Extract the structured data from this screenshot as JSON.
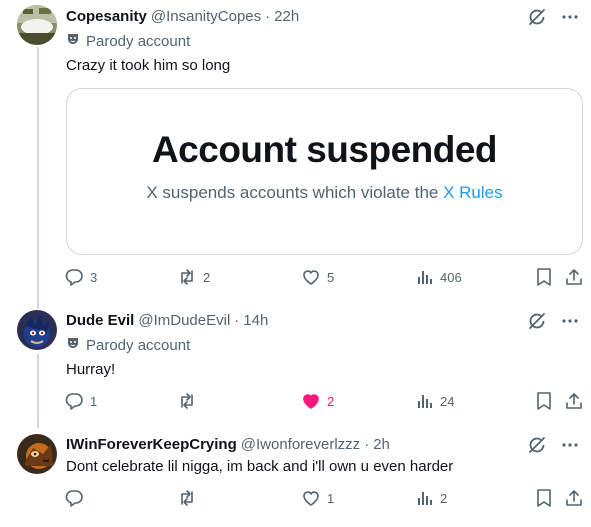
{
  "tweets": [
    {
      "name": "Copesanity",
      "handle": "@InsanityCopes",
      "time": "22h",
      "parody_label": "Parody account",
      "text": "Crazy it took him so long",
      "card": {
        "title": "Account suspended",
        "subtitle_prefix": "X suspends accounts which violate the ",
        "subtitle_link": "X Rules"
      },
      "replies": "3",
      "reposts": "2",
      "likes": "5",
      "views": "406"
    },
    {
      "name": "Dude Evil",
      "handle": "@ImDudeEvil",
      "time": "14h",
      "parody_label": "Parody account",
      "text": "Hurray!",
      "replies": "1",
      "reposts": "",
      "likes": "2",
      "liked": true,
      "views": "24"
    },
    {
      "name": "IWinForeverKeepCrying",
      "handle": "@Iwonforeverlzzz",
      "time": "2h",
      "text": "Dont celebrate lil nigga, im back and i'll own u even harder",
      "replies": "",
      "reposts": "",
      "likes": "1",
      "views": "2"
    }
  ],
  "separator": "·",
  "icons": {
    "reply": "reply-icon",
    "repost": "repost-icon",
    "like": "heart-icon",
    "views": "views-icon",
    "bookmark": "bookmark-icon",
    "share": "share-icon",
    "grok": "grok-icon",
    "more": "more-icon",
    "parody": "parody-mask-icon"
  },
  "colors": {
    "text": "#0f1419",
    "secondary": "#536471",
    "link": "#1d9bf0",
    "like_active": "#f91880",
    "border": "#cfd9de"
  }
}
